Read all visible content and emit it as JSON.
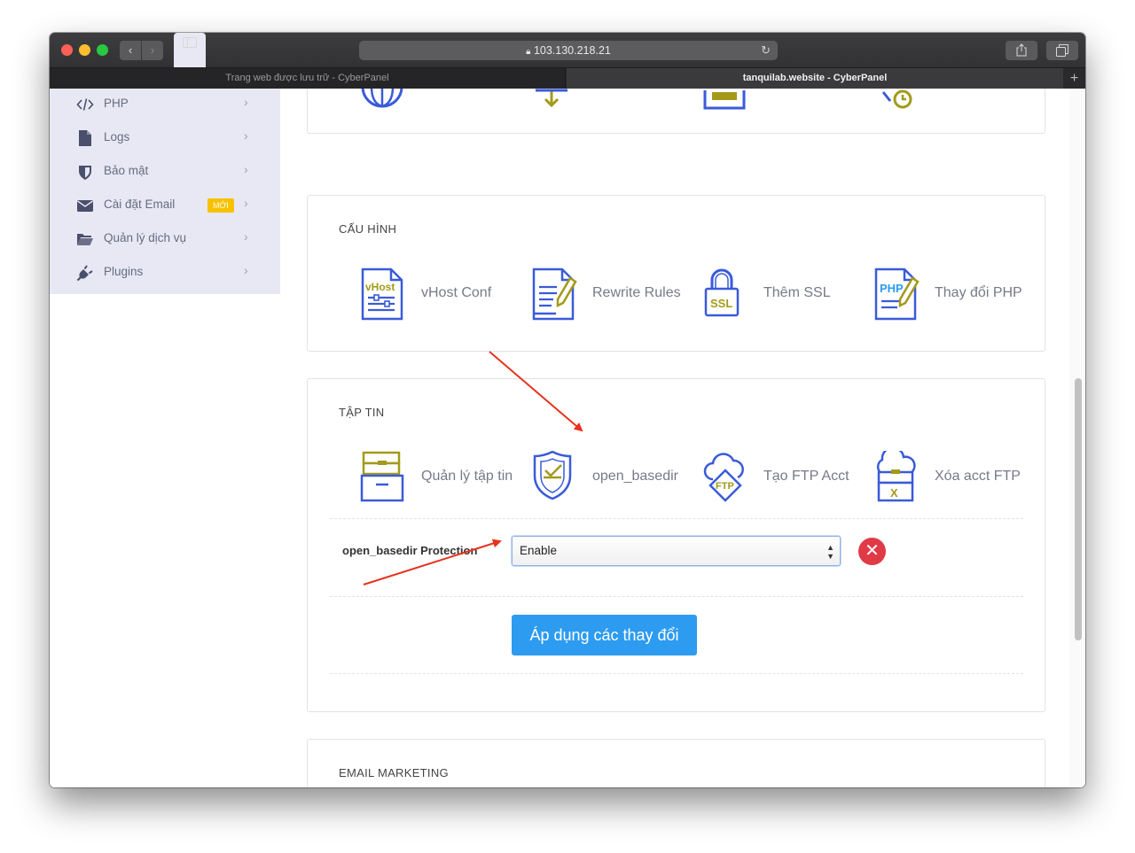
{
  "browser": {
    "url": "103.130.218.21",
    "tabs": [
      {
        "label": "Trang web được lưu trữ - CyberPanel",
        "active": false
      },
      {
        "label": "tanquilab.website - CyberPanel",
        "active": true
      }
    ]
  },
  "sidebar": {
    "items": [
      {
        "label": "PHP",
        "icon": "code-icon"
      },
      {
        "label": "Logs",
        "icon": "file-icon"
      },
      {
        "label": "Bảo mật",
        "icon": "shield-icon"
      },
      {
        "label": "Cài đặt Email",
        "icon": "mail-icon",
        "badge": "MỚI"
      },
      {
        "label": "Quản lý dịch vụ",
        "icon": "folder-open-icon"
      },
      {
        "label": "Plugins",
        "icon": "plug-icon"
      }
    ]
  },
  "sections": {
    "config": {
      "title": "CẤU HÌNH",
      "tools": [
        {
          "label": "vHost Conf",
          "icon": "vhost-conf-icon"
        },
        {
          "label": "Rewrite Rules",
          "icon": "rewrite-rules-icon"
        },
        {
          "label": "Thêm SSL",
          "icon": "ssl-lock-icon"
        },
        {
          "label": "Thay đổi PHP",
          "icon": "php-file-icon"
        }
      ]
    },
    "files": {
      "title": "TẬP TIN",
      "tools": [
        {
          "label": "Quản lý tập tin",
          "icon": "file-manager-icon"
        },
        {
          "label": "open_basedir",
          "icon": "shield-check-icon"
        },
        {
          "label": "Tạo FTP Acct",
          "icon": "ftp-cloud-icon"
        },
        {
          "label": "Xóa acct FTP",
          "icon": "ftp-delete-icon"
        }
      ],
      "form": {
        "label": "open_basedir Protection",
        "selected": "Enable",
        "apply_label": "Áp dụng các thay đổi"
      }
    },
    "email_marketing": {
      "title": "EMAIL MARKETING"
    }
  },
  "colors": {
    "accent": "#2d9bf0",
    "delete": "#e03a47",
    "annotation_arrow": "#e8321e",
    "sidebar_bg": "#e8e8f4",
    "icon_blue": "#3a5bd9",
    "icon_olive": "#a39a1a"
  }
}
